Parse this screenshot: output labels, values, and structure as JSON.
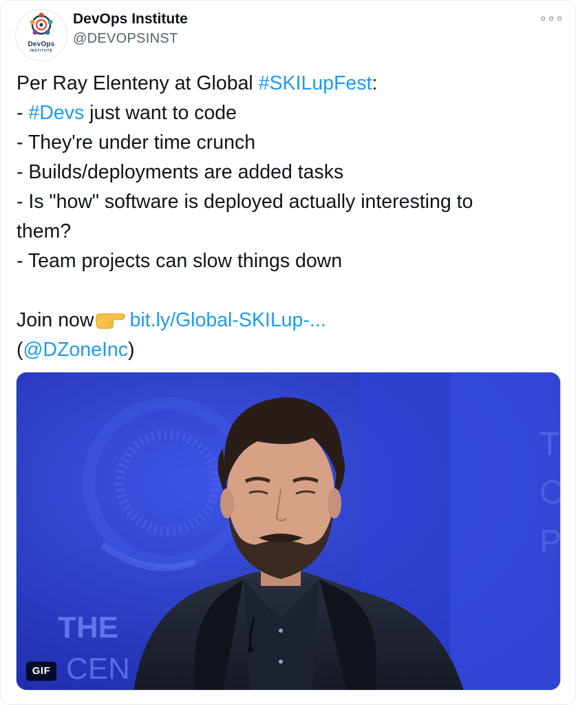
{
  "author": {
    "name": "DevOps Institute",
    "handle": "@DEVOPSINST",
    "avatar_text": "DevOps",
    "avatar_subtext": "INSTITUTE"
  },
  "menu": {
    "icon": "more-horizontal-icon"
  },
  "tweet": {
    "line1_prefix": "Per Ray Elenteny at Global ",
    "line1_hashtag": "#SKILupFest",
    "line1_suffix": ":",
    "line2_prefix": "- ",
    "line2_hashtag": "#Devs",
    "line2_suffix": " just want to code",
    "line3": "- They're under time crunch",
    "line4": "- Builds/deployments are added tasks",
    "line5": "- Is \"how\" software is deployed actually interesting to",
    "line6": "them?",
    "line7": "- Team projects can slow things down",
    "join_text": "Join now",
    "join_emoji": "backhand-index-pointing-right-emoji",
    "join_link": "bit.ly/Global-SKILup-...",
    "mention_open": "(",
    "mention": "@DZoneInc",
    "mention_close": ")"
  },
  "media": {
    "type": "gif",
    "badge": "GIF",
    "bg_text_1": "THE",
    "bg_text_2": "CEN"
  },
  "colors": {
    "link": "#1d9bf0",
    "text": "#0f1419",
    "secondary": "#536471",
    "media_bg": "#2a38c4"
  }
}
